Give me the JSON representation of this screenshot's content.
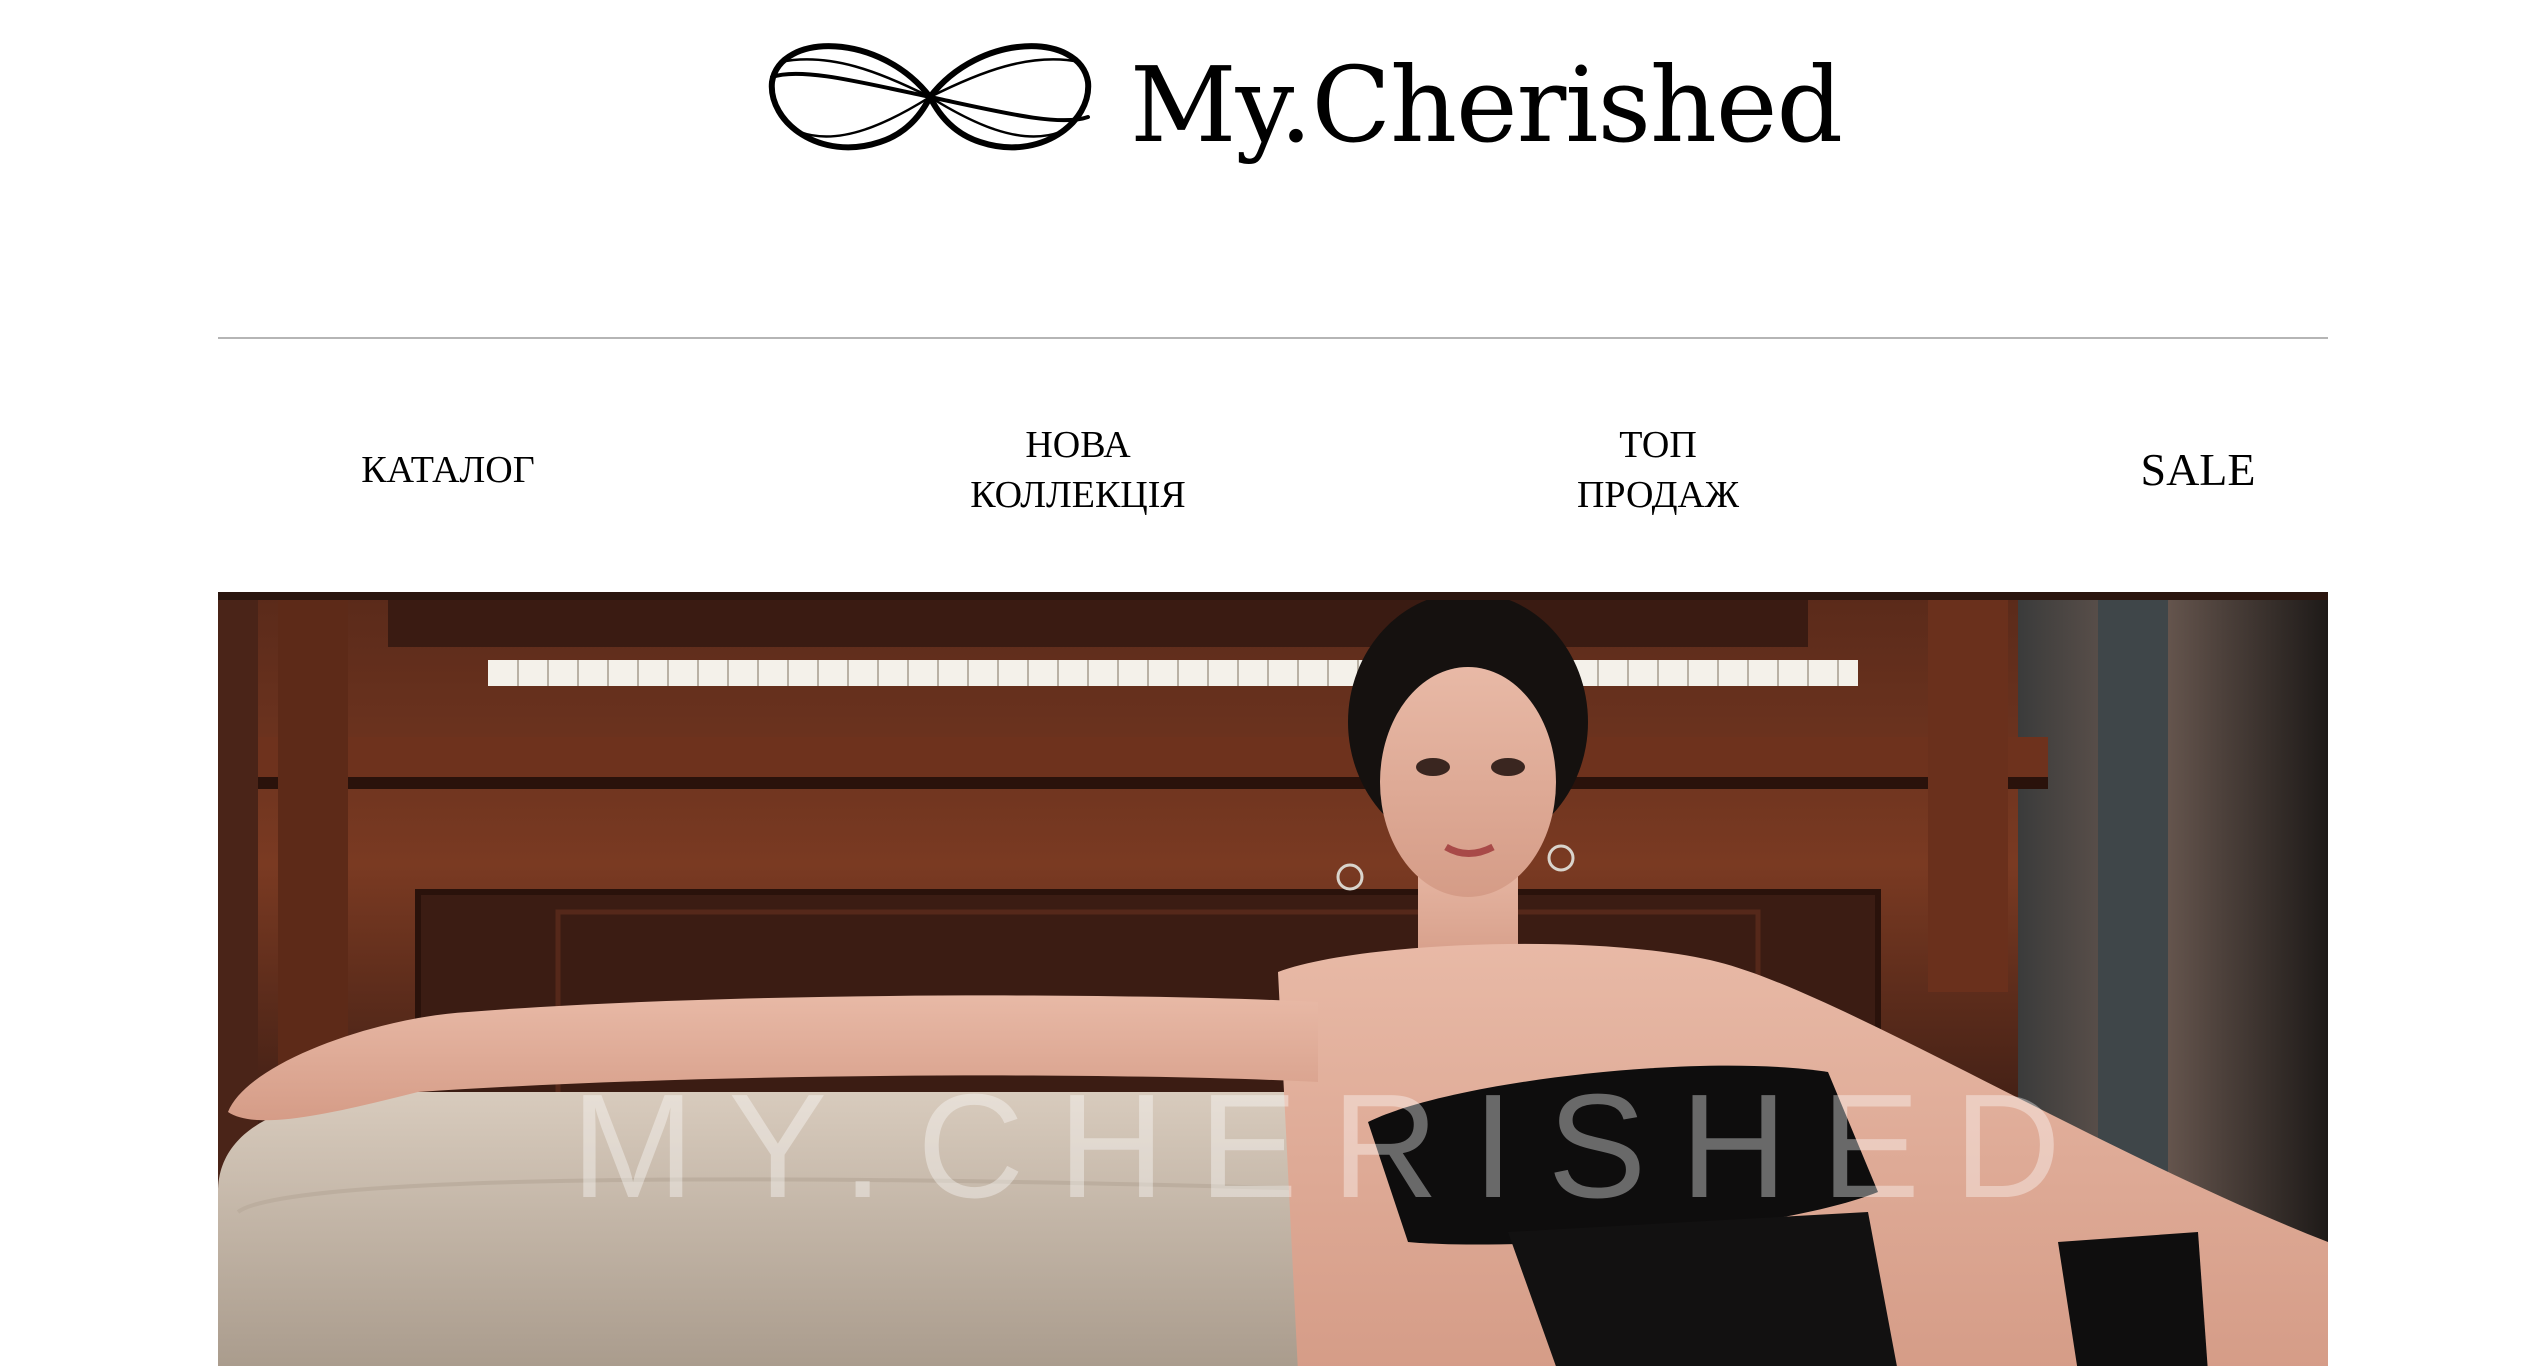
{
  "brand": {
    "name": "My.Cherished",
    "logo_icon": "infinity-swirl-logo"
  },
  "nav": {
    "items": [
      {
        "label": "КАТАЛОГ"
      },
      {
        "label": "НОВА\nКОЛЛЕКЦІЯ"
      },
      {
        "label": "ТОП\nПРОДАЖ"
      },
      {
        "label": "SALE"
      }
    ]
  },
  "hero": {
    "watermark": "MY.CHERISHED"
  },
  "colors": {
    "background": "#ffffff",
    "text": "#000000",
    "divider": "#b5b5b5"
  }
}
